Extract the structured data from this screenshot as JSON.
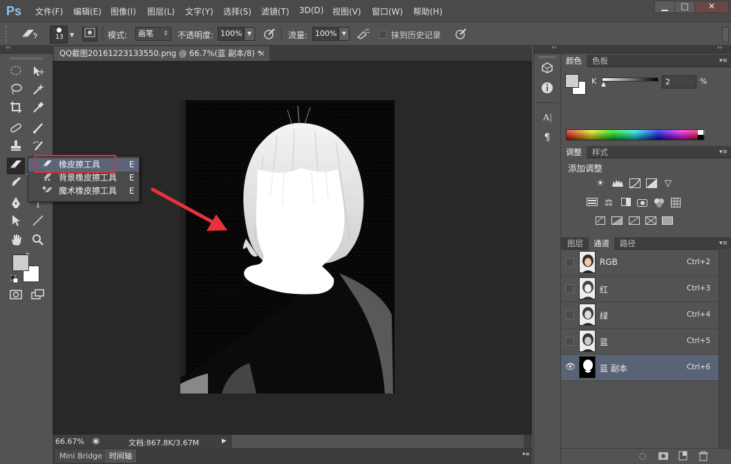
{
  "app": {
    "logo": "Ps",
    "menu": [
      "文件(F)",
      "编辑(E)",
      "图像(I)",
      "图层(L)",
      "文字(Y)",
      "选择(S)",
      "滤镜(T)",
      "3D(D)",
      "视图(V)",
      "窗口(W)",
      "帮助(H)"
    ],
    "window_buttons": {
      "minimize": "▁",
      "restore": "□",
      "close": "✕"
    }
  },
  "options_bar": {
    "brush_size": "13",
    "mode_label": "模式:",
    "mode_value": "画笔",
    "opacity_label": "不透明度:",
    "opacity_value": "100%",
    "flow_label": "流量:",
    "flow_value": "100%",
    "erase_history_label": "抹到历史记录"
  },
  "document": {
    "tab_title": "QQ截图20161223133550.png @ 66.7%(蓝 副本/8) *",
    "tab_close": "×"
  },
  "status": {
    "zoom": "66.67%",
    "doc_info": "文档:867.8K/3.67M"
  },
  "bottom_tabs": [
    "Mini Bridge",
    "时间轴"
  ],
  "flyout": {
    "items": [
      {
        "label": "橡皮擦工具",
        "key": "E"
      },
      {
        "label": "背景橡皮擦工具",
        "key": "E"
      },
      {
        "label": "魔术橡皮擦工具",
        "key": "E"
      }
    ]
  },
  "color_panel": {
    "tabs": [
      "颜色",
      "色板"
    ],
    "channel_label": "K",
    "value": "2",
    "unit": "%"
  },
  "adjust_panel": {
    "tabs": [
      "调整",
      "样式"
    ],
    "title": "添加调整"
  },
  "channels_panel": {
    "tabs": [
      "图层",
      "通道",
      "路径"
    ],
    "rows": [
      {
        "name": "RGB",
        "key": "Ctrl+2",
        "visible": false,
        "selected": false
      },
      {
        "name": "红",
        "key": "Ctrl+3",
        "visible": false,
        "selected": false
      },
      {
        "name": "绿",
        "key": "Ctrl+4",
        "visible": false,
        "selected": false
      },
      {
        "name": "蓝",
        "key": "Ctrl+5",
        "visible": false,
        "selected": false
      },
      {
        "name": "蓝 副本",
        "key": "Ctrl+6",
        "visible": true,
        "selected": true
      }
    ]
  },
  "colors": {
    "highlight_box": "#e03030",
    "arrow": "#e8323c",
    "selected_row": "#586375"
  }
}
